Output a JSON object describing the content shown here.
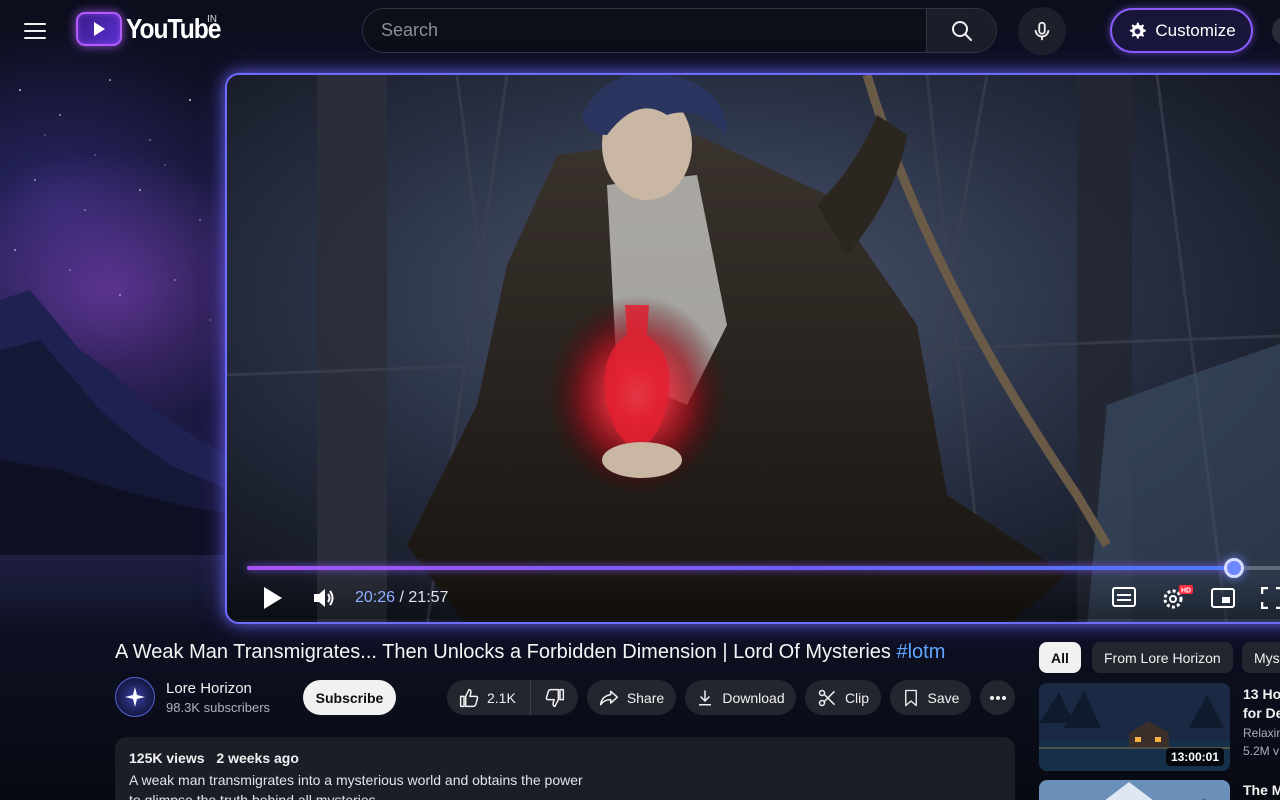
{
  "header": {
    "logo_text": "YouTube",
    "country_code": "IN",
    "search_placeholder": "Search",
    "customize_label": "Customize"
  },
  "player": {
    "current_time": "20:26",
    "separator": "/",
    "duration": "21:57",
    "progress_fraction": 0.9307,
    "settings_badge": "HD"
  },
  "video": {
    "title": "A Weak Man Transmigrates... Then Unlocks a Forbidden Dimension | Lord Of Mysteries",
    "hashtag": "#lotm",
    "channel_name": "Lore Horizon",
    "subscribers": "98.3K subscribers",
    "subscribe_label": "Subscribe",
    "likes": "2.1K",
    "share_label": "Share",
    "download_label": "Download",
    "clip_label": "Clip",
    "save_label": "Save",
    "views": "125K views",
    "posted": "2 weeks ago",
    "description": "A weak man transmigrates into a mysterious world and obtains the power to glimpse the truth behind all mysteries."
  },
  "rail": {
    "chips": [
      "All",
      "From Lore Horizon",
      "Mys"
    ],
    "recommendations": [
      {
        "title_line1": "13 Ho",
        "title_line2": "for De",
        "channel": "Relaxin",
        "meta": "5.2M v",
        "duration": "13:00:01"
      },
      {
        "title_line1": "The M",
        "title_line2": "",
        "channel": "",
        "meta": "",
        "duration": ""
      }
    ]
  },
  "colors": {
    "accent_purple": "#a855f7",
    "accent_blue": "#6d6cff",
    "hashtag_blue": "#5ea6ff",
    "background": "#0a0c16"
  }
}
